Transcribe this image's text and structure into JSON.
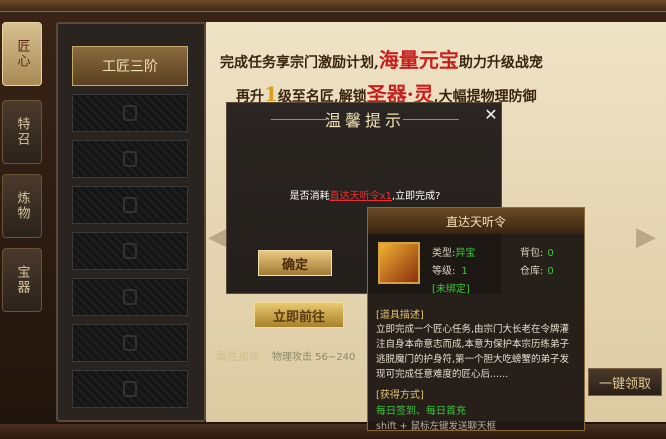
{
  "tabs": [
    "匠心",
    "特召",
    "炼物",
    "宝器"
  ],
  "left_panel": {
    "first_slot": "工匠三阶"
  },
  "headline": {
    "line1_a": "完成任务享宗门激励计划,",
    "line1_big": "海量元宝",
    "line1_b": "助力升级战宠",
    "line2_a": "再升",
    "line2_num": "1",
    "line2_b": "级至名匠,解锁",
    "line2_big": "圣器·灵",
    "line2_c": ",大幅提物理防御"
  },
  "buttons": {
    "goto": "立即前往",
    "claim": "一键领取",
    "ok": "确定"
  },
  "bonus": {
    "label": "属性加成",
    "text": "物理攻击 56~240"
  },
  "dialog": {
    "title": "温馨提示",
    "close": "✕",
    "msg_prefix": "是否消耗",
    "msg_item": "直达天听令x1",
    "msg_suffix": ",立即完成?"
  },
  "tooltip": {
    "title": "直达天听令",
    "type_label": "类型:",
    "type_value": "异宝",
    "level_label": "等级:",
    "level_value": "1",
    "bag_label": "背包:",
    "bag_value": "0",
    "storage_label": "仓库:",
    "storage_value": "0",
    "bind": "[未绑定]",
    "desc_header": "[道具描述]",
    "desc": "立即完成一个匠心任务,由宗门大长老在令牌灌注自身本命意志而成,本意为保护本宗历练弟子逃脱魔门的护身符,第一个胆大吃螃蟹的弟子发现可完成任意难度的匠心后......",
    "obtain_header": "[获得方式]",
    "obtain": "每日签到、每日首充",
    "hint": "shift + 鼠标左键发送聊天框"
  }
}
